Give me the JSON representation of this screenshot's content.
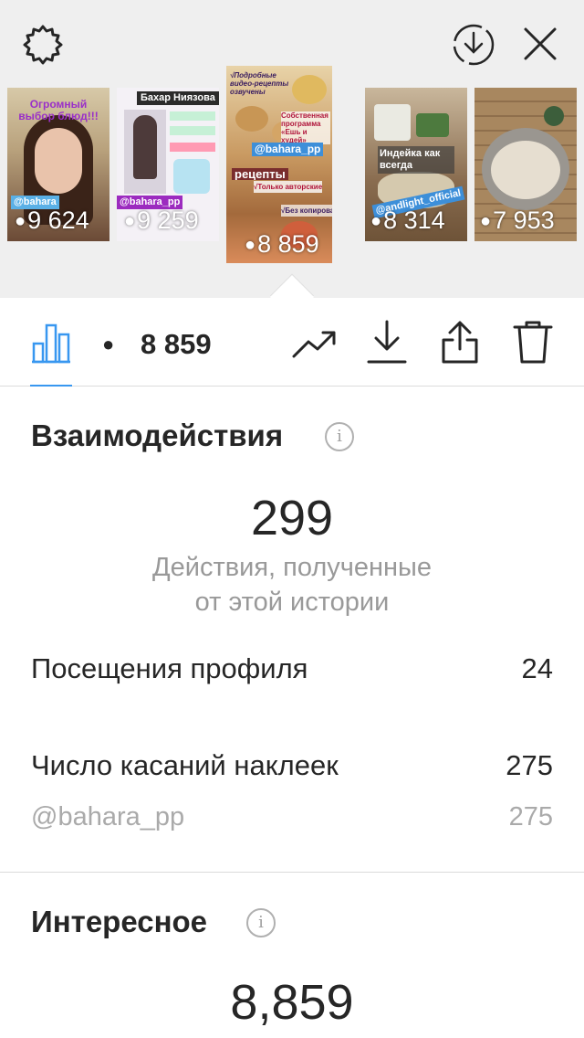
{
  "top_bar": {
    "icons": [
      "gear-icon",
      "download-circle-icon",
      "close-icon"
    ]
  },
  "thumbnails": [
    {
      "caption": "Огромный выбор блюд!!!",
      "handle": "@bahara",
      "views": "9 624"
    },
    {
      "caption": "Бахар Ниязова",
      "handle": "@bahara_pp",
      "views": "9 259"
    },
    {
      "caption_top": "√Подробные видео-рецепты озвучены",
      "caption_mid": "Собственная программа «Ешь и худей»",
      "handle": "@bahara_pp",
      "headline": "рецепты",
      "caption_low": "√Только авторские",
      "caption_bottom": "√Без копирования",
      "views": "8 859"
    },
    {
      "caption": "Индейка как всегда",
      "handle": "@andlight_official",
      "views": "8 314"
    },
    {
      "caption": "",
      "views": "7 953"
    }
  ],
  "toolbar": {
    "eye_glyph": "●",
    "views": "8 859",
    "icons": [
      "bar-chart-icon",
      "trend-icon",
      "download-icon",
      "share-icon",
      "trash-icon"
    ]
  },
  "interactions": {
    "title": "Взаимодействия",
    "info_glyph": "i",
    "total": "299",
    "subtitle_line1": "Действия, полученные",
    "subtitle_line2": "от этой истории",
    "rows": [
      {
        "label": "Посещения профиля",
        "value": "24"
      },
      {
        "label": "Число касаний наклеек",
        "value": "275"
      },
      {
        "label": "@bahara_pp",
        "value": "275"
      }
    ]
  },
  "discovery": {
    "title": "Интересное",
    "info_glyph": "i",
    "total": "8,859"
  },
  "colors": {
    "accent": "#3897f0",
    "text": "#262626",
    "muted": "#999999",
    "strip_bg": "#efefef"
  }
}
